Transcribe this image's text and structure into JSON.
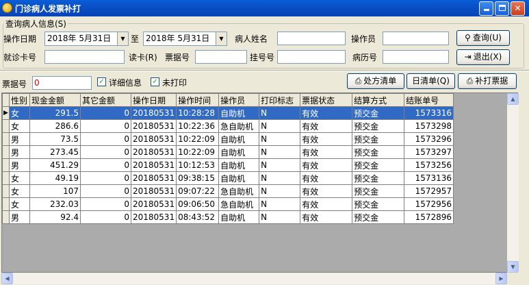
{
  "window": {
    "title": "门诊病人发票补打"
  },
  "group": {
    "legend": "查询病人信息(S)"
  },
  "form": {
    "op_date_label": "操作日期",
    "date_from": "2018年  5月31日",
    "to_label": "至",
    "date_to": "2018年  5月31日",
    "patient_name_label": "病人姓名",
    "operator_label": "操作员",
    "card_label": "就诊卡号",
    "read_card_label": "读卡(R)",
    "receipt_no_label": "票据号",
    "reg_no_label": "挂号号",
    "record_no_label": "病历号",
    "query_button": "查询(U)",
    "exit_button": "退出(X)"
  },
  "toolbar": {
    "receipt_label": "票据号",
    "receipt_value": "0",
    "detail_info_label": "详细信息",
    "detail_checked": true,
    "not_printed_label": "未打印",
    "not_printed_checked": true,
    "prescription_button": "处方清单",
    "daily_button": "日清单(Q)",
    "reprint_button": "补打票据"
  },
  "grid": {
    "columns": [
      "性别",
      "现金金额",
      "其它金额",
      "操作日期",
      "操作时间",
      "操作员",
      "打印标志",
      "票据状态",
      "结算方式",
      "结账单号"
    ],
    "rows": [
      [
        "女",
        "291.5",
        "0",
        "20180531",
        "10:28:28",
        "自助机",
        "N",
        "有效",
        "预交金",
        "1573316"
      ],
      [
        "女",
        "286.6",
        "0",
        "20180531",
        "10:22:36",
        "急自助机",
        "N",
        "有效",
        "预交金",
        "1573298"
      ],
      [
        "男",
        "73.5",
        "0",
        "20180531",
        "10:22:09",
        "自助机",
        "N",
        "有效",
        "预交金",
        "1573296"
      ],
      [
        "男",
        "273.45",
        "0",
        "20180531",
        "10:22:09",
        "自助机",
        "N",
        "有效",
        "预交金",
        "1573297"
      ],
      [
        "男",
        "451.29",
        "0",
        "20180531",
        "10:12:53",
        "自助机",
        "N",
        "有效",
        "预交金",
        "1573256"
      ],
      [
        "女",
        "49.19",
        "0",
        "20180531",
        "09:38:15",
        "自助机",
        "N",
        "有效",
        "预交金",
        "1573136"
      ],
      [
        "女",
        "107",
        "0",
        "20180531",
        "09:07:22",
        "急自助机",
        "N",
        "有效",
        "预交金",
        "1572957"
      ],
      [
        "女",
        "232.03",
        "0",
        "20180531",
        "09:06:50",
        "急自助机",
        "N",
        "有效",
        "预交金",
        "1572956"
      ],
      [
        "男",
        "92.4",
        "0",
        "20180531",
        "08:43:52",
        "自助机",
        "N",
        "有效",
        "预交金",
        "1572896"
      ]
    ],
    "selected_row": 0
  },
  "colors": {
    "titlebar": "#0a4fc6",
    "selection": "#316ac5",
    "window": "#ece9d8"
  }
}
